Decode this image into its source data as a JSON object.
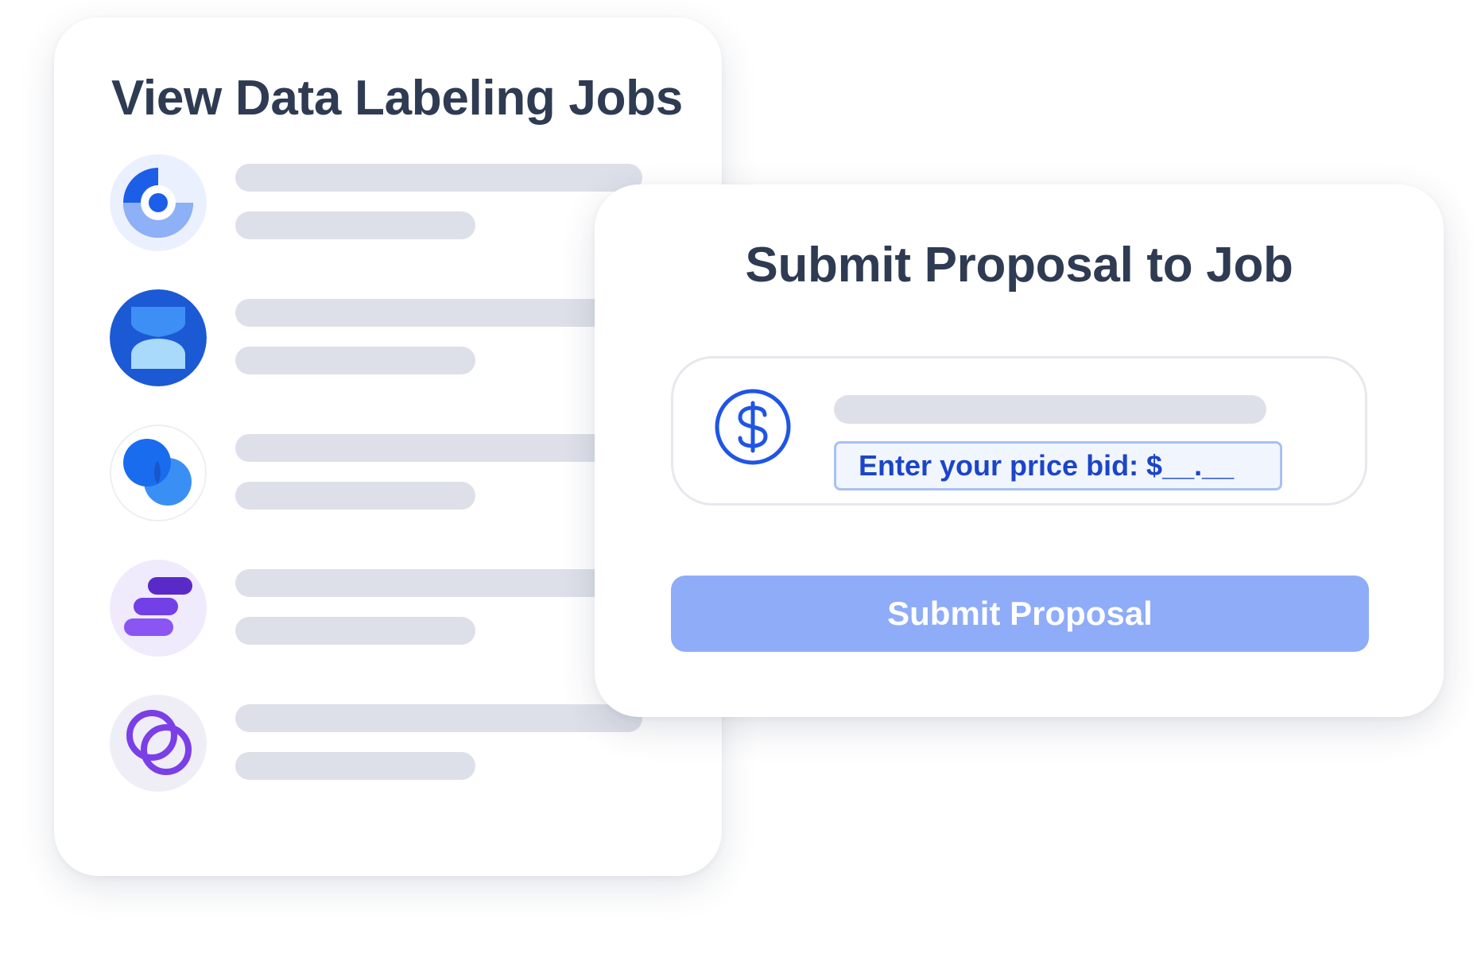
{
  "jobs_panel": {
    "title": "View Data Labeling Jobs",
    "jobs": [
      {
        "icon": "ring-chart-logo-icon",
        "accent": "#1c5ee8"
      },
      {
        "icon": "hourglass-logo-icon",
        "accent": "#1c59d4"
      },
      {
        "icon": "overlapping-circles-logo-icon",
        "accent": "#1a6cef"
      },
      {
        "icon": "stacked-bars-logo-icon",
        "accent": "#6a35e0"
      },
      {
        "icon": "linked-rings-logo-icon",
        "accent": "#7a3fe6"
      }
    ]
  },
  "proposal_panel": {
    "title": "Submit Proposal to Job",
    "bid": {
      "icon": "dollar-circle-icon",
      "input_value": "Enter your price bid: $__.__"
    },
    "submit_label": "Submit Proposal"
  },
  "colors": {
    "title_text": "#2e3b52",
    "placeholder_bar": "#dde0e9",
    "accent_blue": "#1b45c9",
    "button": "#8eacf8",
    "button_text": "#ffffff"
  }
}
